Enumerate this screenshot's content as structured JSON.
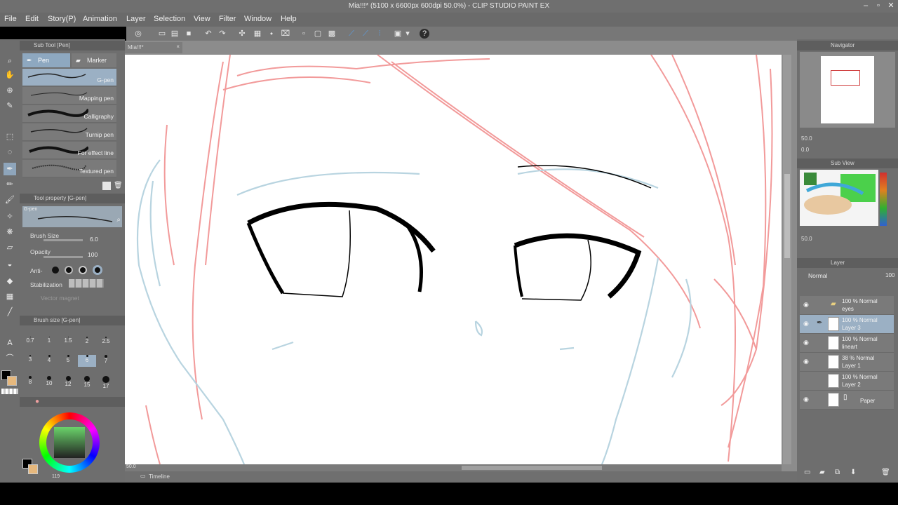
{
  "titlebar": {
    "title": "Mia!!!* (5100 x 6600px 600dpi 50.0%) - CLIP STUDIO PAINT EX",
    "minimize_icon": "minimize-icon",
    "maximize_icon": "maximize-icon",
    "close_icon": "close-icon"
  },
  "menubar": {
    "items": [
      "File",
      "Edit",
      "Story(P)",
      "Animation",
      "Layer",
      "Selection",
      "View",
      "Filter",
      "Window",
      "Help"
    ]
  },
  "subtool": {
    "header": "Sub Tool [Pen]",
    "tabs": [
      "Pen",
      "Marker"
    ],
    "brushes": [
      "G-pen",
      "Mapping pen",
      "Calligraphy",
      "Turnip pen",
      "For effect line",
      "Textured pen"
    ],
    "selected_index": 0
  },
  "toolproperty": {
    "header": "Tool property [G-pen]",
    "preview_label": "G-pen",
    "brush_size_label": "Brush Size",
    "brush_size_value": "6.0",
    "opacity_label": "Opacity",
    "opacity_value": "100",
    "antialias_label": "Anti-",
    "stabilization_label": "Stabilization",
    "vector_label": "Vector magnet"
  },
  "brushsize": {
    "header": "Brush size [G-pen]",
    "sizes": [
      "0.7",
      "1",
      "1.5",
      "2",
      "2.5",
      "3",
      "4",
      "5",
      "6",
      "7",
      "8",
      "10",
      "12",
      "15",
      "17"
    ],
    "selected": "6"
  },
  "color": {
    "main": "#000000",
    "sub": "#e6b87d",
    "bottom_readout": "119"
  },
  "canvas": {
    "tab_label": "Mia!!!*",
    "zoom": "50.0",
    "timeline_label": "Timeline"
  },
  "navigator": {
    "header": "Navigator",
    "zoom": "50.0",
    "rotate": "0.0"
  },
  "subview": {
    "header": "Sub View",
    "zoom": "50.0"
  },
  "layerpanel": {
    "header": "Layer",
    "blend_mode": "Normal",
    "opacity": "100",
    "layers": [
      {
        "mode": "100 % Normal",
        "name": "eyes",
        "folder": true,
        "visible": true
      },
      {
        "mode": "100 % Normal",
        "name": "Layer 3",
        "folder": false,
        "visible": true,
        "selected": true
      },
      {
        "mode": "100 % Normal",
        "name": "lineart",
        "folder": false,
        "visible": true
      },
      {
        "mode": "38 % Normal",
        "name": "Layer 1",
        "folder": false,
        "visible": true
      },
      {
        "mode": "100 % Normal",
        "name": "Layer 2",
        "folder": false,
        "visible": false
      },
      {
        "mode": "",
        "name": "Paper",
        "folder": false,
        "visible": true
      }
    ]
  },
  "colors": {
    "sketch_red": "#f29a9a",
    "sketch_blue": "#b8d4e0",
    "selection_blue": "#9bb0c4"
  }
}
